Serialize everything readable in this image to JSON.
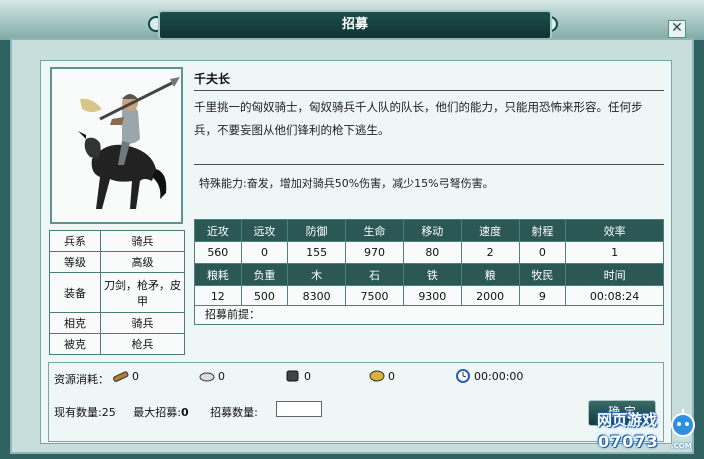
{
  "window": {
    "title": "招募",
    "close_label": "✕"
  },
  "unit": {
    "name": "千夫长",
    "description": "千里挑一的匈奴骑士，匈奴骑兵千人队的队长，他们的能力，只能用恐怖来形容。任何步兵，不要妄图从他们锋利的枪下逃生。",
    "special": "特殊能力:奋发，增加对骑兵50%伤害，减少15%弓弩伤害。"
  },
  "attributes": [
    {
      "key": "兵系",
      "value": "骑兵"
    },
    {
      "key": "等级",
      "value": "高级"
    },
    {
      "key": "装备",
      "value": "刀剑，枪矛，皮甲"
    },
    {
      "key": "相克",
      "value": "骑兵"
    },
    {
      "key": "被克",
      "value": "枪兵"
    }
  ],
  "stats": {
    "headers1": [
      "近攻",
      "远攻",
      "防御",
      "生命",
      "移动",
      "速度",
      "射程",
      "效率"
    ],
    "values1": [
      "560",
      "0",
      "155",
      "970",
      "80",
      "2",
      "0",
      "1"
    ],
    "headers2": [
      "粮耗",
      "负重",
      "木",
      "石",
      "铁",
      "粮",
      "牧民",
      "时间"
    ],
    "values2": [
      "12",
      "500",
      "8300",
      "7500",
      "9300",
      "2000",
      "9",
      "00:08:24"
    ]
  },
  "prerequisite_label": "招募前提：",
  "resources": {
    "label": "资源消耗：",
    "items": [
      {
        "icon": "wood-icon",
        "value": "0"
      },
      {
        "icon": "stone-icon",
        "value": "0"
      },
      {
        "icon": "iron-icon",
        "value": "0"
      },
      {
        "icon": "grain-icon",
        "value": "0"
      },
      {
        "icon": "clock-icon",
        "value": "00:00:00"
      }
    ]
  },
  "recruit": {
    "current_label": "现有数量:",
    "current_value": "25",
    "max_label": "最大招募:",
    "max_value": "0",
    "qty_label": "招募数量:",
    "qty_value": ""
  },
  "confirm_label": "确 定",
  "watermark": {
    "line1": "网页游戏",
    "line2": "07073",
    "line3": ".COM"
  }
}
